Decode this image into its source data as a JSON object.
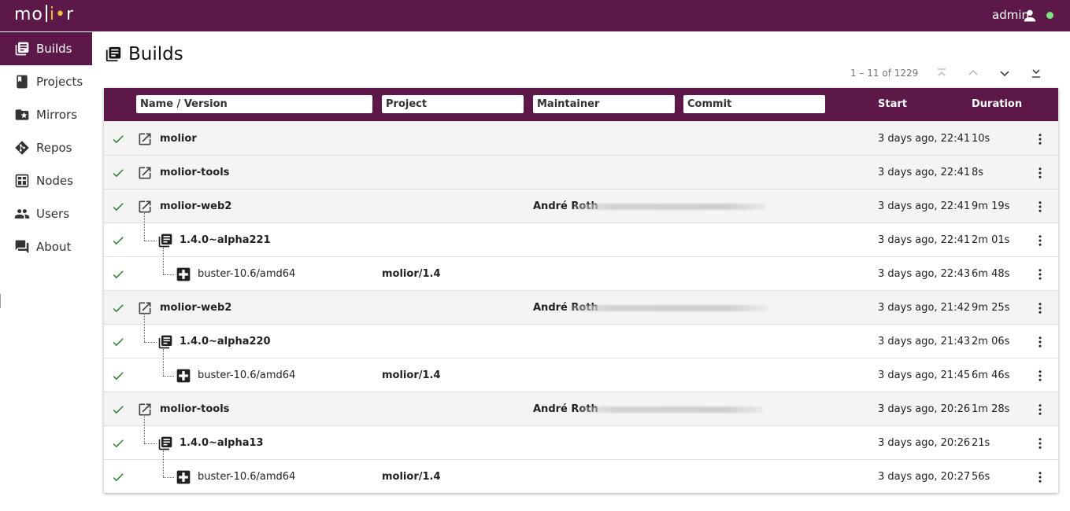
{
  "app": {
    "logo": "mo|i•r",
    "user": "admin",
    "colors": {
      "brand": "#5b1848",
      "accent": "#f2c037",
      "online": "#7ee07e",
      "success": "#2e7d32"
    }
  },
  "sidebar": {
    "items": [
      {
        "label": "Builds",
        "icon": "builds-icon",
        "active": true
      },
      {
        "label": "Projects",
        "icon": "book-icon",
        "active": false
      },
      {
        "label": "Mirrors",
        "icon": "folder-star-icon",
        "active": false
      },
      {
        "label": "Repos",
        "icon": "git-icon",
        "active": false
      },
      {
        "label": "Nodes",
        "icon": "nodes-icon",
        "active": false
      },
      {
        "label": "Users",
        "icon": "users-icon",
        "active": false
      },
      {
        "label": "About",
        "icon": "chat-icon",
        "active": false
      }
    ]
  },
  "page": {
    "title": "Builds"
  },
  "pagination": {
    "range": "1 – 11 of 1229"
  },
  "table": {
    "filters": {
      "name": "Name / Version",
      "project": "Project",
      "maintainer": "Maintainer",
      "commit": "Commit"
    },
    "headers": {
      "start": "Start",
      "duration": "Duration"
    },
    "rows": [
      {
        "type": "source",
        "name": "molior",
        "project": "",
        "maintainer": "",
        "start": "3 days ago, 22:41",
        "duration": "10s"
      },
      {
        "type": "source",
        "name": "molior-tools",
        "project": "",
        "maintainer": "",
        "start": "3 days ago, 22:41",
        "duration": "8s"
      },
      {
        "type": "source",
        "name": "molior-web2",
        "project": "",
        "maintainer": "André Roth",
        "start": "3 days ago, 22:41",
        "duration": "9m 19s"
      },
      {
        "type": "version",
        "name": "1.4.0~alpha221",
        "project": "",
        "maintainer": "",
        "start": "3 days ago, 22:41",
        "duration": "2m 01s"
      },
      {
        "type": "build",
        "name": "buster-10.6/amd64",
        "project": "molior/1.4",
        "maintainer": "",
        "start": "3 days ago, 22:43",
        "duration": "6m 48s"
      },
      {
        "type": "source",
        "name": "molior-web2",
        "project": "",
        "maintainer": "André Roth",
        "start": "3 days ago, 21:42",
        "duration": "9m 25s"
      },
      {
        "type": "version",
        "name": "1.4.0~alpha220",
        "project": "",
        "maintainer": "",
        "start": "3 days ago, 21:43",
        "duration": "2m 06s"
      },
      {
        "type": "build",
        "name": "buster-10.6/amd64",
        "project": "molior/1.4",
        "maintainer": "",
        "start": "3 days ago, 21:45",
        "duration": "6m 46s"
      },
      {
        "type": "source",
        "name": "molior-tools",
        "project": "",
        "maintainer": "André Roth",
        "start": "3 days ago, 20:26",
        "duration": "1m 28s"
      },
      {
        "type": "version",
        "name": "1.4.0~alpha13",
        "project": "",
        "maintainer": "",
        "start": "3 days ago, 20:26",
        "duration": "21s"
      },
      {
        "type": "build",
        "name": "buster-10.6/amd64",
        "project": "molior/1.4",
        "maintainer": "",
        "start": "3 days ago, 20:27",
        "duration": "56s"
      }
    ]
  }
}
